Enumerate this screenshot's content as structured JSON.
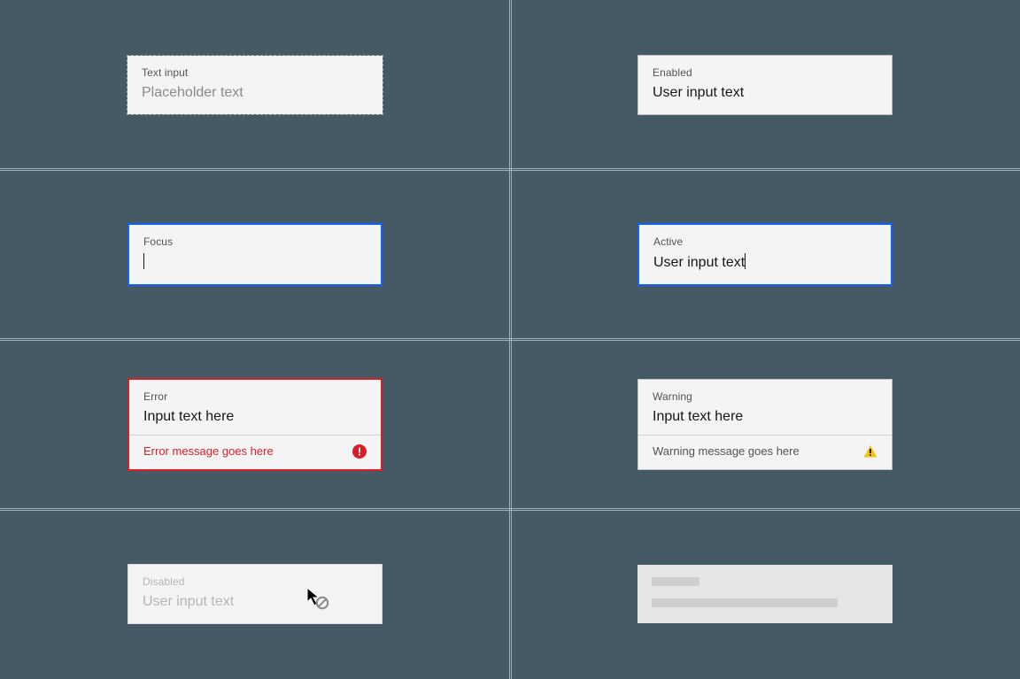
{
  "panels": {
    "default": {
      "label": "Text input",
      "placeholder": "Placeholder text"
    },
    "enabled": {
      "label": "Enabled",
      "value": "User input text"
    },
    "focus": {
      "label": "Focus",
      "value": ""
    },
    "active": {
      "label": "Active",
      "value": "User input text"
    },
    "error": {
      "label": "Error",
      "value": "Input text here",
      "message": "Error message goes here"
    },
    "warning": {
      "label": "Warning",
      "value": "Input text here",
      "message": "Warning message goes here"
    },
    "disabled": {
      "label": "Disabled",
      "value": "User input text"
    }
  },
  "colors": {
    "background": "#455a64",
    "field_bg": "#f4f4f4",
    "focus_border": "#0f62fe",
    "error": "#da1e28",
    "warning": "#f1c21b",
    "text_primary": "#161616",
    "text_secondary": "#525252",
    "placeholder": "#8a8a8a"
  }
}
